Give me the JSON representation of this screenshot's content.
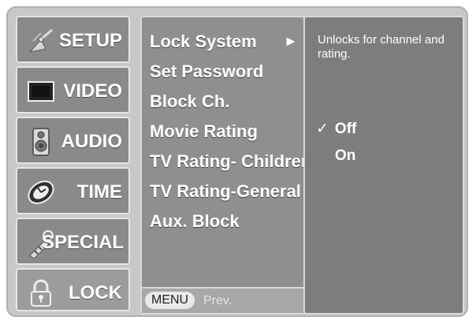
{
  "sidebar": {
    "tiles": [
      {
        "label": "SETUP",
        "icon": "satellite-icon"
      },
      {
        "label": "VIDEO",
        "icon": "monitor-icon"
      },
      {
        "label": "AUDIO",
        "icon": "speaker-icon"
      },
      {
        "label": "TIME",
        "icon": "clock-icon"
      },
      {
        "label": "SPECIAL",
        "icon": "key-icon"
      },
      {
        "label": "LOCK",
        "icon": "lock-icon"
      }
    ]
  },
  "menu": {
    "items": [
      "Lock System",
      "Set Password",
      "Block Ch.",
      "Movie Rating",
      "TV Rating- Children",
      "TV Rating-General",
      "Aux. Block"
    ],
    "active_index": 0,
    "active_arrow": "►",
    "bottom": {
      "menu_button": "MENU",
      "prev_label": "Prev."
    }
  },
  "right_panel": {
    "help_text": "Unlocks for channel and rating.",
    "options": [
      {
        "label": "Off",
        "selected": true
      },
      {
        "label": "On",
        "selected": false
      }
    ],
    "check_glyph": "✓"
  }
}
